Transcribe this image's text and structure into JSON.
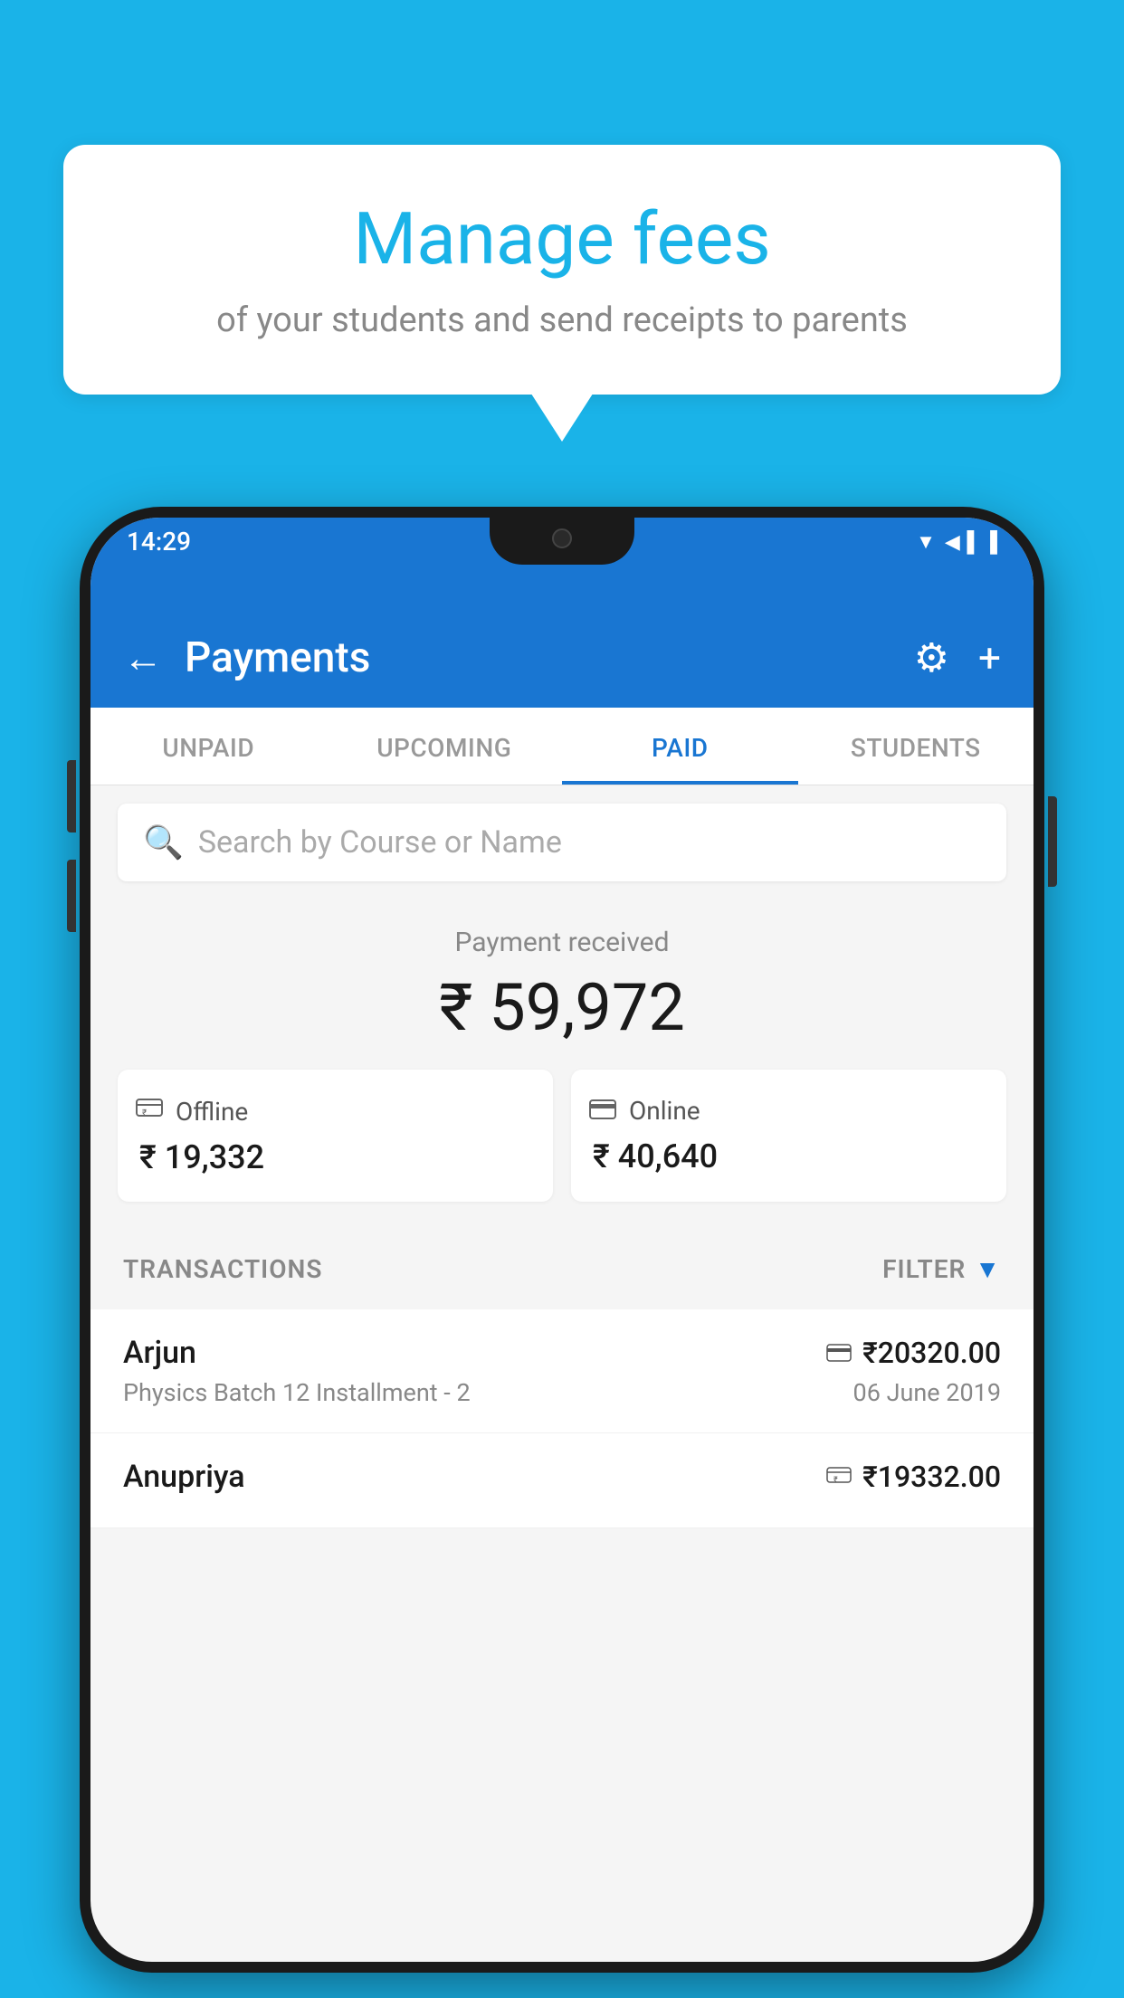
{
  "background_color": "#1ab3e8",
  "hero": {
    "title": "Manage fees",
    "subtitle": "of your students and send receipts to parents"
  },
  "phone": {
    "status_bar": {
      "time": "14:29",
      "icons": "▼◀▐"
    },
    "header": {
      "title": "Payments",
      "back_label": "←",
      "settings_label": "⚙",
      "add_label": "+"
    },
    "tabs": [
      {
        "label": "UNPAID",
        "active": false
      },
      {
        "label": "UPCOMING",
        "active": false
      },
      {
        "label": "PAID",
        "active": true
      },
      {
        "label": "STUDENTS",
        "active": false
      }
    ],
    "search": {
      "placeholder": "Search by Course or Name"
    },
    "payment_summary": {
      "label": "Payment received",
      "total": "₹ 59,972",
      "offline": {
        "icon": "💳",
        "label": "Offline",
        "amount": "₹ 19,332"
      },
      "online": {
        "icon": "💳",
        "label": "Online",
        "amount": "₹ 40,640"
      }
    },
    "transactions": {
      "header_label": "TRANSACTIONS",
      "filter_label": "FILTER",
      "items": [
        {
          "name": "Arjun",
          "detail": "Physics Batch 12 Installment - 2",
          "amount": "₹20320.00",
          "date": "06 June 2019",
          "payment_type": "online"
        },
        {
          "name": "Anupriya",
          "detail": "",
          "amount": "₹19332.00",
          "date": "",
          "payment_type": "offline"
        }
      ]
    }
  }
}
